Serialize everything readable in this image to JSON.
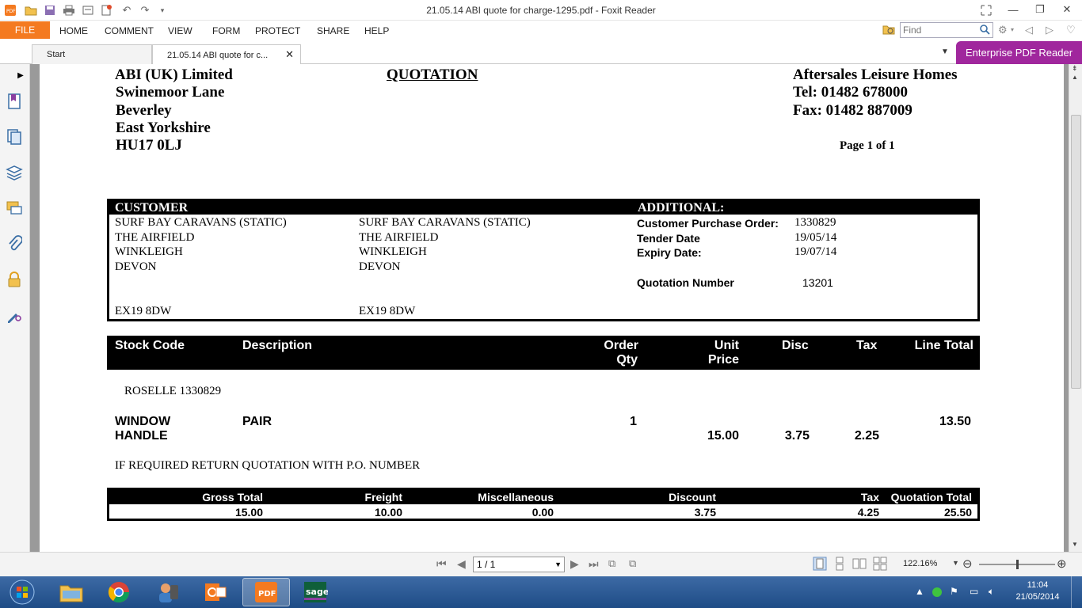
{
  "window": {
    "title": "21.05.14 ABI quote for charge-1295.pdf - Foxit Reader",
    "controls": [
      "minimize",
      "restore",
      "close"
    ]
  },
  "ribbon": {
    "file_label": "FILE",
    "menus": [
      "HOME",
      "COMMENT",
      "VIEW",
      "FORM",
      "PROTECT",
      "SHARE",
      "HELP"
    ],
    "find_placeholder": "Find"
  },
  "tabs": [
    {
      "label": "Start"
    },
    {
      "label": "21.05.14 ABI quote for c..."
    }
  ],
  "enterprise_label": "Enterprise PDF Reader",
  "document": {
    "supplier": [
      "ABI (UK) Limited",
      "Swinemoor Lane",
      "Beverley",
      "East Yorkshire",
      "HU17 0LJ"
    ],
    "heading": "QUOTATION",
    "company": {
      "name": "Aftersales Leisure Homes",
      "tel": "Tel: 01482 678000",
      "fax": "Fax: 01482 887009"
    },
    "page_label": "Page 1 of 1",
    "customer_header": "CUSTOMER",
    "additional_header": "ADDITIONAL:",
    "customer_address_1": [
      "SURF BAY CARAVANS (STATIC)",
      "THE AIRFIELD",
      "WINKLEIGH",
      "DEVON"
    ],
    "customer_postcode_1": "EX19 8DW",
    "customer_address_2": [
      "SURF BAY CARAVANS (STATIC)",
      "THE AIRFIELD",
      "WINKLEIGH",
      "DEVON"
    ],
    "customer_postcode_2": "EX19 8DW",
    "additional": {
      "po_label": "Customer Purchase Order:",
      "po_value": "1330829",
      "tender_label": "Tender Date",
      "tender_value": "19/05/14",
      "expiry_label": "Expiry Date:",
      "expiry_value": "19/07/14",
      "quote_label": "Quotation Number",
      "quote_value": "13201"
    },
    "table_headers": {
      "stock_code": "Stock Code",
      "description": "Description",
      "order_qty_1": "Order",
      "order_qty_2": "Qty",
      "unit_price_1": "Unit",
      "unit_price_2": "Price",
      "disc": "Disc",
      "tax": "Tax",
      "line_total": "Line Total"
    },
    "reference_line": "ROSELLE 1330829",
    "line_item": {
      "stock_code_1": "WINDOW",
      "stock_code_2": "HANDLE",
      "description": "PAIR",
      "qty": "1",
      "unit_price": "15.00",
      "disc": "3.75",
      "tax": "2.25",
      "line_total": "13.50"
    },
    "note": "IF REQUIRED RETURN QUOTATION WITH P.O. NUMBER",
    "totals": {
      "gross_label": "Gross Total",
      "gross_value": "15.00",
      "freight_label": "Freight",
      "freight_value": "10.00",
      "misc_label": "Miscellaneous",
      "misc_value": "0.00",
      "discount_label": "Discount",
      "discount_value": "3.75",
      "tax_label": "Tax",
      "tax_value": "4.25",
      "quote_total_label": "Quotation Total",
      "quote_total_value": "25.50"
    }
  },
  "navigation": {
    "page_value": "1 / 1",
    "zoom": "122.16%",
    "zoom_slider_fraction": 0.5
  },
  "taskbar": {
    "apps": [
      "start-orb",
      "file-explorer",
      "chrome",
      "contacts",
      "outlook",
      "foxit-pdf",
      "sage"
    ],
    "time": "11:04",
    "date": "21/05/2014"
  },
  "colors": {
    "file_button": "#f47a20",
    "enterprise_button": "#a0279d",
    "taskbar": "#1e4c86",
    "table_header_bg": "#000000"
  }
}
